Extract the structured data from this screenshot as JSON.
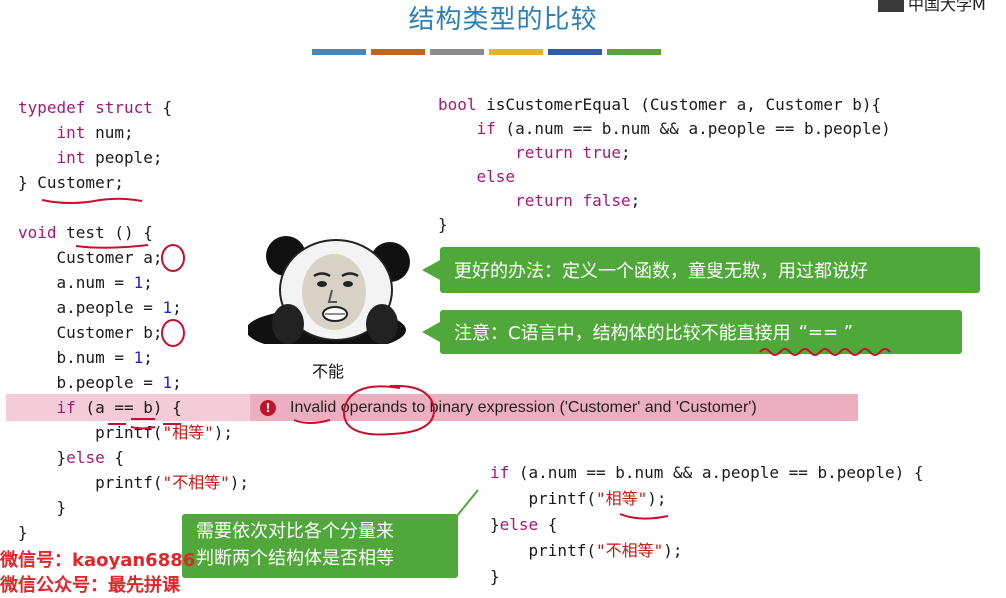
{
  "slide": {
    "title": "结构类型的比较",
    "watermark": "中国大学M",
    "title_bar_colors": [
      "#4a86b8",
      "#c0651f",
      "#8c8c8c",
      "#e4b427",
      "#2f5da8",
      "#5aa43e"
    ]
  },
  "left_code": {
    "lines": [
      "typedef struct {",
      "    int num;",
      "    int people;",
      "} Customer;",
      "",
      "void test () {",
      "    Customer a;",
      "    a.num = 1;",
      "    a.people = 1;",
      "    Customer b;",
      "    b.num = 1;",
      "    b.people = 1;",
      "    if (a == b) {",
      "        printf(\"相等\");",
      "    }else {",
      "        printf(\"不相等\");",
      "    }",
      "}"
    ]
  },
  "right_code": {
    "lines": [
      "bool isCustomerEqual (Customer a, Customer b){",
      "    if (a.num == b.num && a.people == b.people)",
      "        return true;",
      "    else",
      "        return false;",
      "}"
    ]
  },
  "bottom_code": {
    "lines": [
      "if (a.num == b.num && a.people == b.people) {",
      "    printf(\"相等\");",
      "}else {",
      "    printf(\"不相等\");",
      "}"
    ]
  },
  "error": {
    "prefix": "Invalid ",
    "keyword": "operands",
    "suffix": " to binary expression ('Customer' and 'Customer')",
    "icon_label": "!"
  },
  "callouts": {
    "better_way": "更好的办法：定义一个函数，童叟无欺，用过都说好",
    "note_prefix": "注意：C语言中，结构体的比较",
    "note_emphasis": "不能直接用",
    "note_suffix": "“== ”",
    "bottom_line1": "需要依次对比各个分量来",
    "bottom_line2": "判断两个结构体是否相等"
  },
  "meme": {
    "caption": "不能"
  },
  "wechat": {
    "line1": "微信号：kaoyan6886",
    "line2": "微信公众号：最先拼课"
  },
  "colors": {
    "title": "#2d7fb8",
    "callout_green": "#50a83a",
    "annotation_red": "#c8102e",
    "error_highlight": "#ecafc0",
    "keyword": "#a01a7a",
    "number": "#2a20c8",
    "string": "#c41a16"
  }
}
